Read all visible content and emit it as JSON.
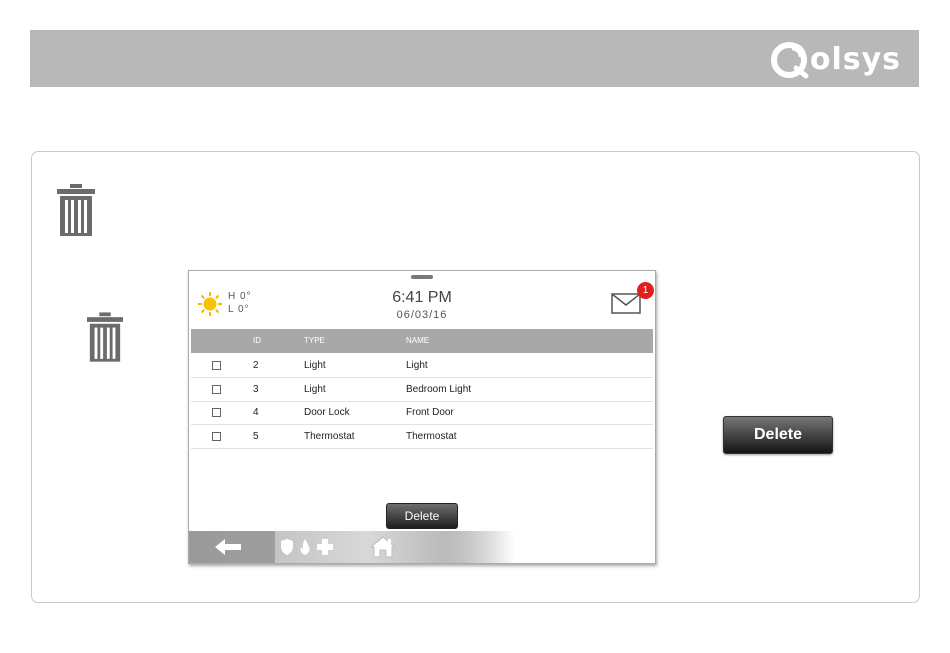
{
  "brand": {
    "name": "olsys",
    "color": "#ffffff"
  },
  "header_band_color": "#b8b8b8",
  "icons": {
    "trash_large": "trash-icon",
    "trash_small": "trash-icon",
    "weather": "sun-icon",
    "messages": "envelope-icon",
    "back": "arrow-left-icon",
    "security": "shield-icon",
    "fire": "flame-icon",
    "medical": "plus-icon",
    "home": "home-icon"
  },
  "panel": {
    "weather": {
      "high": "H 0°",
      "low": "L 0°"
    },
    "clock": {
      "time": "6:41 PM",
      "date": "06/03/16"
    },
    "messages": {
      "badge": "1",
      "badge_color": "#e02020"
    },
    "table": {
      "headers": {
        "id": "ID",
        "type": "TYPE",
        "name": "NAME"
      },
      "rows": [
        {
          "id": "2",
          "type": "Light",
          "name": "Light"
        },
        {
          "id": "3",
          "type": "Light",
          "name": "Bedroom Light"
        },
        {
          "id": "4",
          "type": "Door Lock",
          "name": "Front Door"
        },
        {
          "id": "5",
          "type": "Thermostat",
          "name": "Thermostat"
        }
      ]
    },
    "delete_label": "Delete"
  },
  "delete_button_label": "Delete"
}
